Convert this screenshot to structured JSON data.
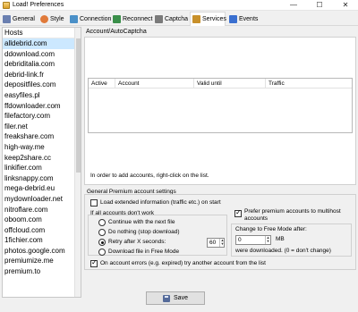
{
  "window": {
    "title": "Load! Preferences",
    "minimize_glyph": "—",
    "maximize_glyph": "☐",
    "close_glyph": "✕"
  },
  "tabs": [
    {
      "label": "General",
      "icon": "gear-icon",
      "color": "#6a7fb0"
    },
    {
      "label": "Style",
      "icon": "palette-icon",
      "color": "#e07a3a"
    },
    {
      "label": "Connection",
      "icon": "network-icon",
      "color": "#4a90c8"
    },
    {
      "label": "Reconnect",
      "icon": "reconnect-icon",
      "color": "#3a8f4a"
    },
    {
      "label": "Captcha",
      "icon": "captcha-icon",
      "color": "#7a7a7a"
    },
    {
      "label": "Services",
      "icon": "services-icon",
      "color": "#c8902a"
    },
    {
      "label": "Events",
      "icon": "events-icon",
      "color": "#3a6fd0"
    }
  ],
  "active_tab": "Services",
  "hosts": {
    "header": "Hosts",
    "items": [
      "alldebrid.com",
      "ddownload.com",
      "debriditalia.com",
      "debrid-link.fr",
      "depositfiles.com",
      "easyfiles.pl",
      "ffdownloader.com",
      "filefactory.com",
      "filer.net",
      "freakshare.com",
      "high-way.me",
      "keep2share.cc",
      "linkifier.com",
      "linksnappy.com",
      "mega-debrid.eu",
      "mydownloader.net",
      "nitroflare.com",
      "oboom.com",
      "offcloud.com",
      "1fichier.com",
      "photos.google.com",
      "premiumize.me",
      "premium.to"
    ],
    "selected": "alldebrid.com"
  },
  "account_panel": {
    "tree_label": "Account/AutoCaptcha",
    "columns": [
      "Active",
      "Account",
      "Valid until",
      "Traffic"
    ],
    "hint": "In order to add accounts, right-click on the list."
  },
  "premium": {
    "title": "General Premium account settings",
    "load_extended": "Load extended information (traffic etc.) on start",
    "load_extended_checked": false,
    "if_fail_label": "If all accounts don't work",
    "options": [
      "Continue with the next file",
      "Do nothing (stop download)",
      "Retry after X seconds:",
      "Download file in Free Mode"
    ],
    "selected_option": "Retry after X seconds:",
    "retry_seconds": "60",
    "prefer_premium": "Prefer premium accounts to multihost accounts",
    "prefer_premium_checked": true,
    "change_free_label": "Change to Free Mode after:",
    "free_mb_value": "0",
    "mb_unit": "MB",
    "free_note": "were downloaded. (0 = don't change)",
    "on_error": "On account errors (e.g. expired) try another account from the list",
    "on_error_checked": true
  },
  "save_label": "Save"
}
